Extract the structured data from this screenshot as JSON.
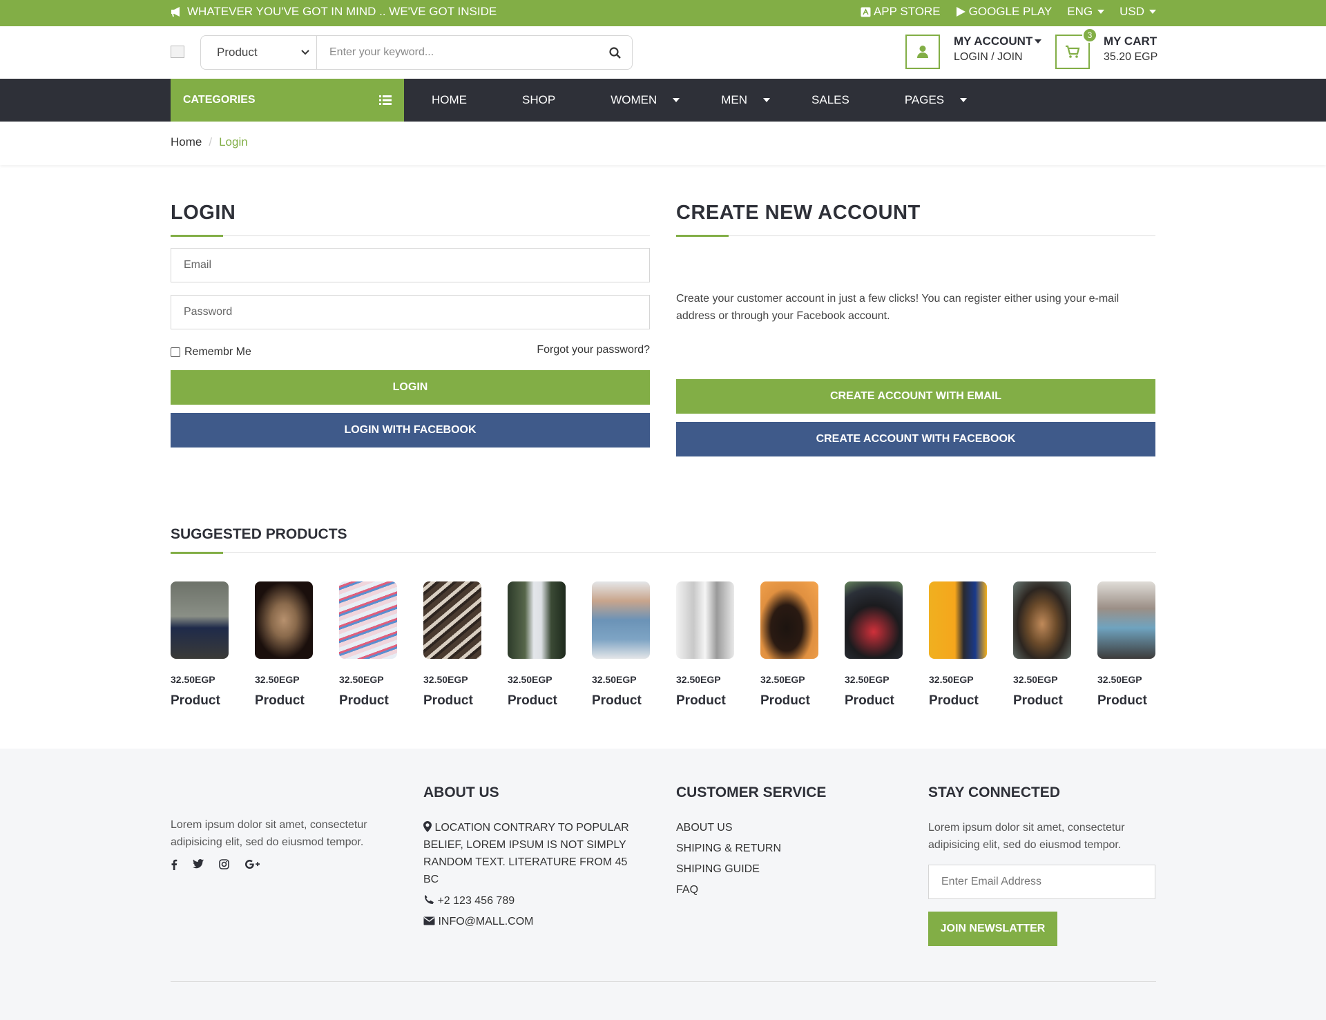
{
  "topbar": {
    "promo": "WHATEVER YOU'VE GOT IN MIND .. WE'VE GOT INSIDE",
    "app_store": "APP STORE",
    "google_play": "GOOGLE PLAY",
    "language": "ENG",
    "currency": "USD"
  },
  "header": {
    "search_category": "Product",
    "search_placeholder": "Enter your keyword...",
    "account_title": "MY ACCOUNT",
    "account_sub": "LOGIN / JOIN",
    "cart_title": "MY CART",
    "cart_total": "35.20 EGP",
    "cart_count": "3"
  },
  "nav": {
    "categories": "CATEGORIES",
    "items": [
      {
        "label": "HOME"
      },
      {
        "label": "SHOP"
      },
      {
        "label": "WOMEN"
      },
      {
        "label": "MEN"
      },
      {
        "label": "SALES"
      },
      {
        "label": "PAGES"
      }
    ]
  },
  "breadcrumb": {
    "home": "Home",
    "sep": "/",
    "current": "Login"
  },
  "login": {
    "title": "LOGIN",
    "email_placeholder": "Email",
    "password_placeholder": "Password",
    "remember": "Remembr Me",
    "forgot": "Forgot your password?",
    "login_button": "LOGIN",
    "facebook_button": "LOGIN WITH FACEBOOK"
  },
  "create": {
    "title": "CREATE NEW ACCOUNT",
    "description": "Create your customer account in just a few clicks! You can register either using your e-mail address or through your Facebook account.",
    "email_button": "CREATE ACCOUNT WITH EMAIL",
    "facebook_button": "CREATE ACCOUNT WITH FACEBOOK"
  },
  "suggested": {
    "title": "SUGGESTED PRODUCTS",
    "products": [
      {
        "price": "32.50EGP",
        "name": "Product"
      },
      {
        "price": "32.50EGP",
        "name": "Product"
      },
      {
        "price": "32.50EGP",
        "name": "Product"
      },
      {
        "price": "32.50EGP",
        "name": "Product"
      },
      {
        "price": "32.50EGP",
        "name": "Product"
      },
      {
        "price": "32.50EGP",
        "name": "Product"
      },
      {
        "price": "32.50EGP",
        "name": "Product"
      },
      {
        "price": "32.50EGP",
        "name": "Product"
      },
      {
        "price": "32.50EGP",
        "name": "Product"
      },
      {
        "price": "32.50EGP",
        "name": "Product"
      },
      {
        "price": "32.50EGP",
        "name": "Product"
      },
      {
        "price": "32.50EGP",
        "name": "Product"
      }
    ]
  },
  "footer": {
    "intro": "Lorem ipsum dolor sit amet, consectetur adipisicing elit, sed do eiusmod tempor.",
    "about_title": "ABOUT US",
    "about_location": "LOCATION CONTRARY TO POPULAR BELIEF, LOREM IPSUM IS NOT SIMPLY RANDOM TEXT. LITERATURE FROM 45 BC",
    "about_phone": "+2 123 456 789",
    "about_email": "INFO@MALL.COM",
    "service_title": "CUSTOMER SERVICE",
    "service_links": [
      {
        "label": "ABOUT US"
      },
      {
        "label": "SHIPING & RETURN"
      },
      {
        "label": "SHIPING GUIDE"
      },
      {
        "label": "FAQ"
      }
    ],
    "connected_title": "STAY CONNECTED",
    "connected_text": "Lorem ipsum dolor sit amet, consectetur adipisicing elit, sed do eiusmod tempor.",
    "newsletter_placeholder": "Enter Email Address",
    "newsletter_button": "JOIN NEWSLATTER"
  },
  "colors": {
    "accent": "#82ae46",
    "dark": "#2e3038",
    "facebook": "#3f5a8a"
  }
}
